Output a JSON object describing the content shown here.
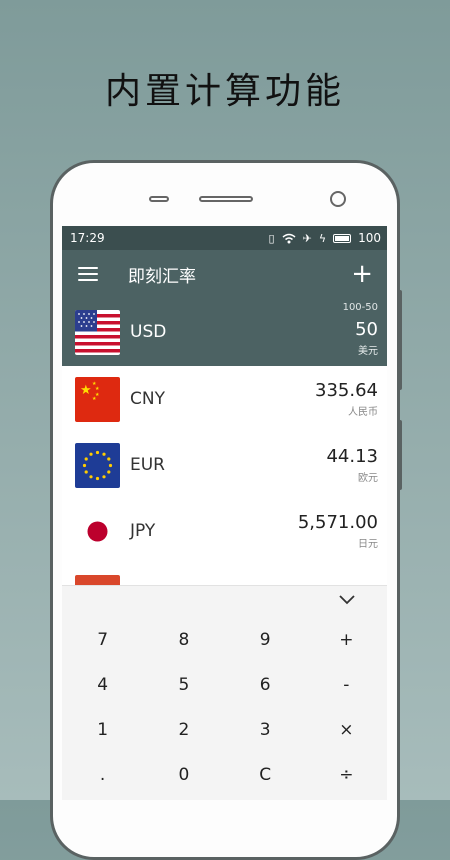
{
  "promo": {
    "title": "内置计算功能"
  },
  "status_bar": {
    "time": "17:29",
    "battery": "100"
  },
  "toolbar": {
    "title": "即刻汇率",
    "add_label": "+"
  },
  "currencies": [
    {
      "code": "USD",
      "amount": "50",
      "unit": "美元",
      "rate_hint": "100-50",
      "selected": true,
      "flag_icon": "us-flag-icon"
    },
    {
      "code": "CNY",
      "amount": "335.64",
      "unit": "人民币",
      "flag_icon": "cn-flag-icon"
    },
    {
      "code": "EUR",
      "amount": "44.13",
      "unit": "欧元",
      "flag_icon": "eu-flag-icon"
    },
    {
      "code": "JPY",
      "amount": "5,571.00",
      "unit": "日元",
      "flag_icon": "jp-flag-icon"
    }
  ],
  "keypad": {
    "keys": [
      "7",
      "8",
      "9",
      "+",
      "4",
      "5",
      "6",
      "-",
      "1",
      "2",
      "3",
      "×",
      ".",
      "0",
      "C",
      "÷"
    ]
  },
  "colors": {
    "header": "#4c6263",
    "status_bar": "#3b4e4f",
    "background": "#8fa8a7"
  }
}
